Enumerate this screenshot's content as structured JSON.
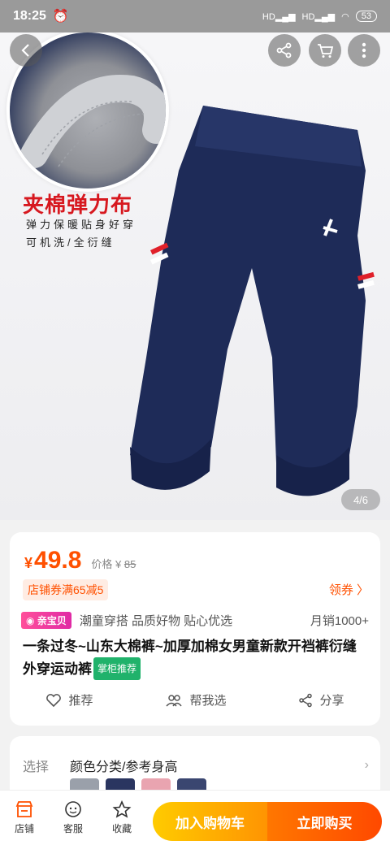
{
  "status": {
    "time": "18:25",
    "signal1": "HD",
    "signal2": "HD",
    "battery": "53"
  },
  "gallery": {
    "promo_title": "夹棉弹力布",
    "promo_line1": "弹力保暖贴身好穿",
    "promo_line2": "可机洗/全衍缝",
    "pager": "4/6"
  },
  "product": {
    "price_symbol": "¥",
    "price": "49.8",
    "original_label": "价格 ¥",
    "original_price": "85",
    "coupon": "店铺券满65减5",
    "coupon_link": "领券 〉",
    "brand_tag": "亲宝贝",
    "tags": "潮童穿搭 品质好物 贴心优选",
    "sales": "月销1000+",
    "title": "一条过冬~山东大棉裤~加厚加棉女男童新款开裆裤衍缝外穿运动裤",
    "title_badge": "掌柜推荐",
    "actions": {
      "recommend": "推荐",
      "help": "帮我选",
      "share": "分享"
    }
  },
  "selection": {
    "label": "选择",
    "value": "颜色分类/参考身高"
  },
  "bottom": {
    "shop": "店铺",
    "service": "客服",
    "favorite": "收藏",
    "add_cart": "加入购物车",
    "buy_now": "立即购买"
  }
}
